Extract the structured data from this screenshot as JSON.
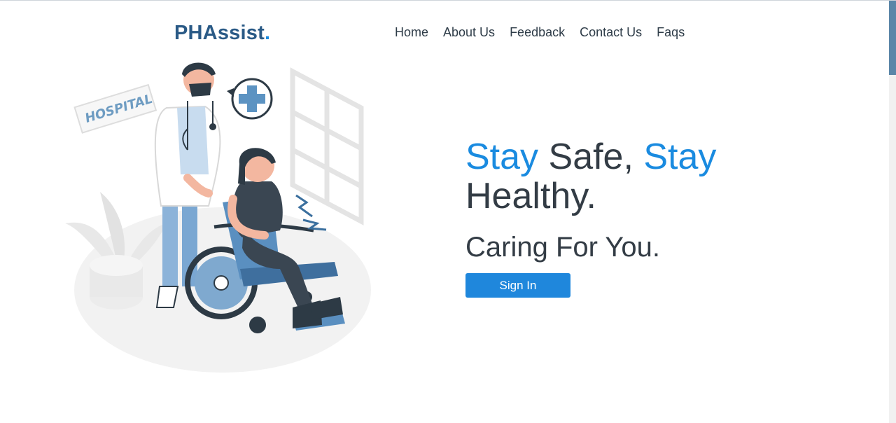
{
  "brand": {
    "name": "PHAssist",
    "dot": "."
  },
  "nav": {
    "items": [
      {
        "label": "Home"
      },
      {
        "label": "About Us"
      },
      {
        "label": "Feedback"
      },
      {
        "label": "Contact Us"
      },
      {
        "label": "Faqs"
      }
    ]
  },
  "illustration": {
    "sign_text": "HOSPITAL"
  },
  "hero": {
    "stay1": "Stay",
    "safe": " Safe, ",
    "stay2": "Stay",
    "healthy": "Healthy.",
    "tagline": "Caring For You.",
    "signin_label": "Sign In"
  },
  "colors": {
    "brand": "#2a5a86",
    "accent": "#1a8be0",
    "text": "#333c45",
    "button": "#1f87dc",
    "scroll_thumb": "#5b86a8"
  }
}
